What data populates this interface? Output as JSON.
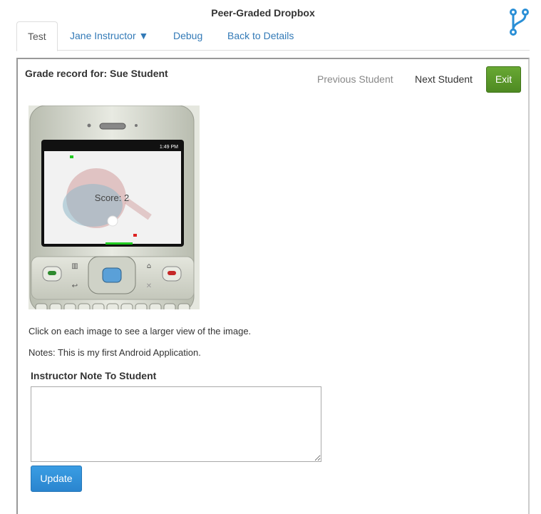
{
  "app": {
    "title": "Peer-Graded Dropbox",
    "logo_icon": "git-branch-icon"
  },
  "tabs": [
    {
      "label": "Test",
      "active": true
    },
    {
      "label": "Jane Instructor ▼",
      "active": false
    },
    {
      "label": "Debug",
      "active": false
    },
    {
      "label": "Back to Details",
      "active": false
    }
  ],
  "grade": {
    "title": "Grade record for: Sue Student",
    "prev_label": "Previous Student",
    "next_label": "Next Student",
    "exit_label": "Exit"
  },
  "submission": {
    "screen_status": "1:49 PM",
    "score_text": "Score: 2",
    "help_text": "Click on each image to see a larger view of the image.",
    "notes_text": "Notes: This is my first Android Application."
  },
  "instructor_note": {
    "label": "Instructor Note To Student",
    "value": "",
    "update_label": "Update"
  },
  "colors": {
    "link": "#337ab7",
    "exit_button": "#5a9b2b",
    "update_button": "#3090dc"
  }
}
